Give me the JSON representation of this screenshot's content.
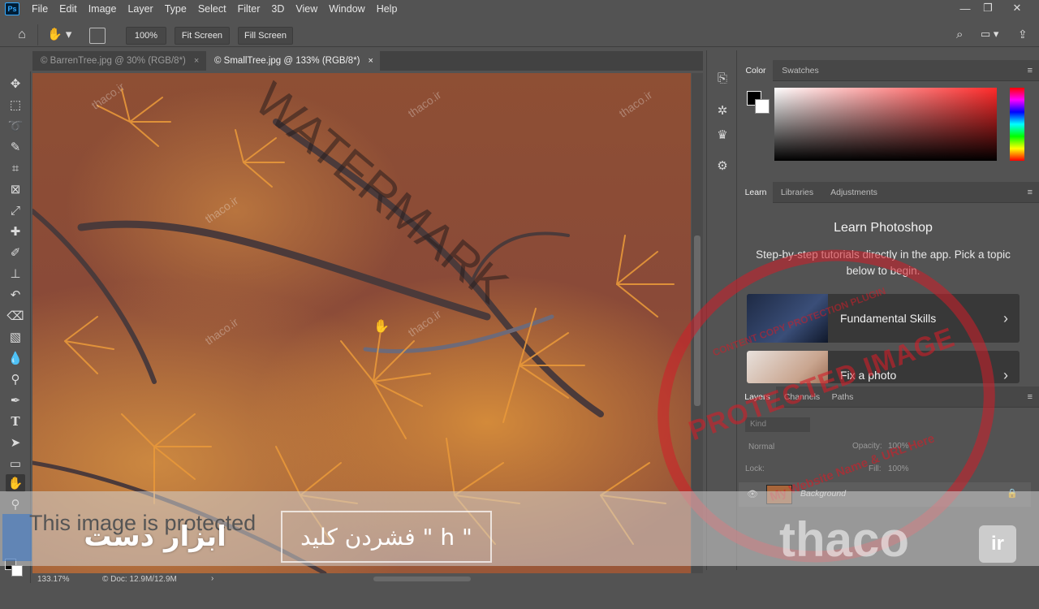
{
  "menubar": {
    "logo": "Ps",
    "items": [
      "File",
      "Edit",
      "Image",
      "Layer",
      "Type",
      "Select",
      "Filter",
      "3D",
      "View",
      "Window",
      "Help"
    ]
  },
  "options": {
    "zoom_button": "100%",
    "fit_button": "Fit Screen",
    "fill_button": "Fill Screen"
  },
  "tabs": [
    {
      "label": "© BarrenTree.jpg @ 30% (RGB/8*)",
      "close": "×"
    },
    {
      "label": "© SmallTree.jpg @ 133% (RGB/8*)",
      "close": "×"
    }
  ],
  "status": {
    "zoom": "133.17%",
    "doc": "© Doc: 12.9M/12.9M",
    "arrow": "›"
  },
  "panels": {
    "color_tabs": [
      "Color",
      "Swatches"
    ],
    "learn_tabs": [
      "Learn",
      "Libraries",
      "Adjustments"
    ],
    "learn_title": "Learn Photoshop",
    "learn_subtitle": "Step-by-step tutorials directly in the app. Pick a topic below to begin.",
    "cards": [
      {
        "label": "Fundamental Skills",
        "chevron": "›"
      },
      {
        "label": "Fix a photo",
        "chevron": "›"
      }
    ],
    "layers_tabs": [
      "Layers",
      "Channels",
      "Paths"
    ],
    "layers": {
      "filter_placeholder": "Kind",
      "blend_mode": "Normal",
      "opacity_label": "Opacity:",
      "opacity_value": "100%",
      "lock_label": "Lock:",
      "fill_label": "Fill:",
      "fill_value": "100%",
      "layer_name": "Background"
    }
  },
  "overlay": {
    "protected_text": "This image is protected",
    "tool_label_fa": "ابزار دست",
    "shortcut_fa": "فشردن کلید \" h \"",
    "watermark_site": "thaco.ir",
    "watermark_big": "WATERMARK",
    "stamp_main": "PROTECTED IMAGE",
    "stamp_top": "CONTENT COPY PROTECTION PLUGIN",
    "stamp_bottom": "My Website Name & URL Here",
    "logo_word": "thaco",
    "logo_suffix": "ir"
  },
  "icons": {
    "tools": [
      "move-icon",
      "marquee-icon",
      "lasso-icon",
      "quick-select-icon",
      "crop-icon",
      "frame-icon",
      "eyedropper-icon",
      "healing-icon",
      "brush-icon",
      "stamp-icon",
      "history-brush-icon",
      "eraser-icon",
      "gradient-icon",
      "blur-icon",
      "dodge-icon",
      "pen-icon",
      "type-icon",
      "path-select-icon",
      "rectangle-icon",
      "hand-icon",
      "zoom-icon"
    ]
  }
}
